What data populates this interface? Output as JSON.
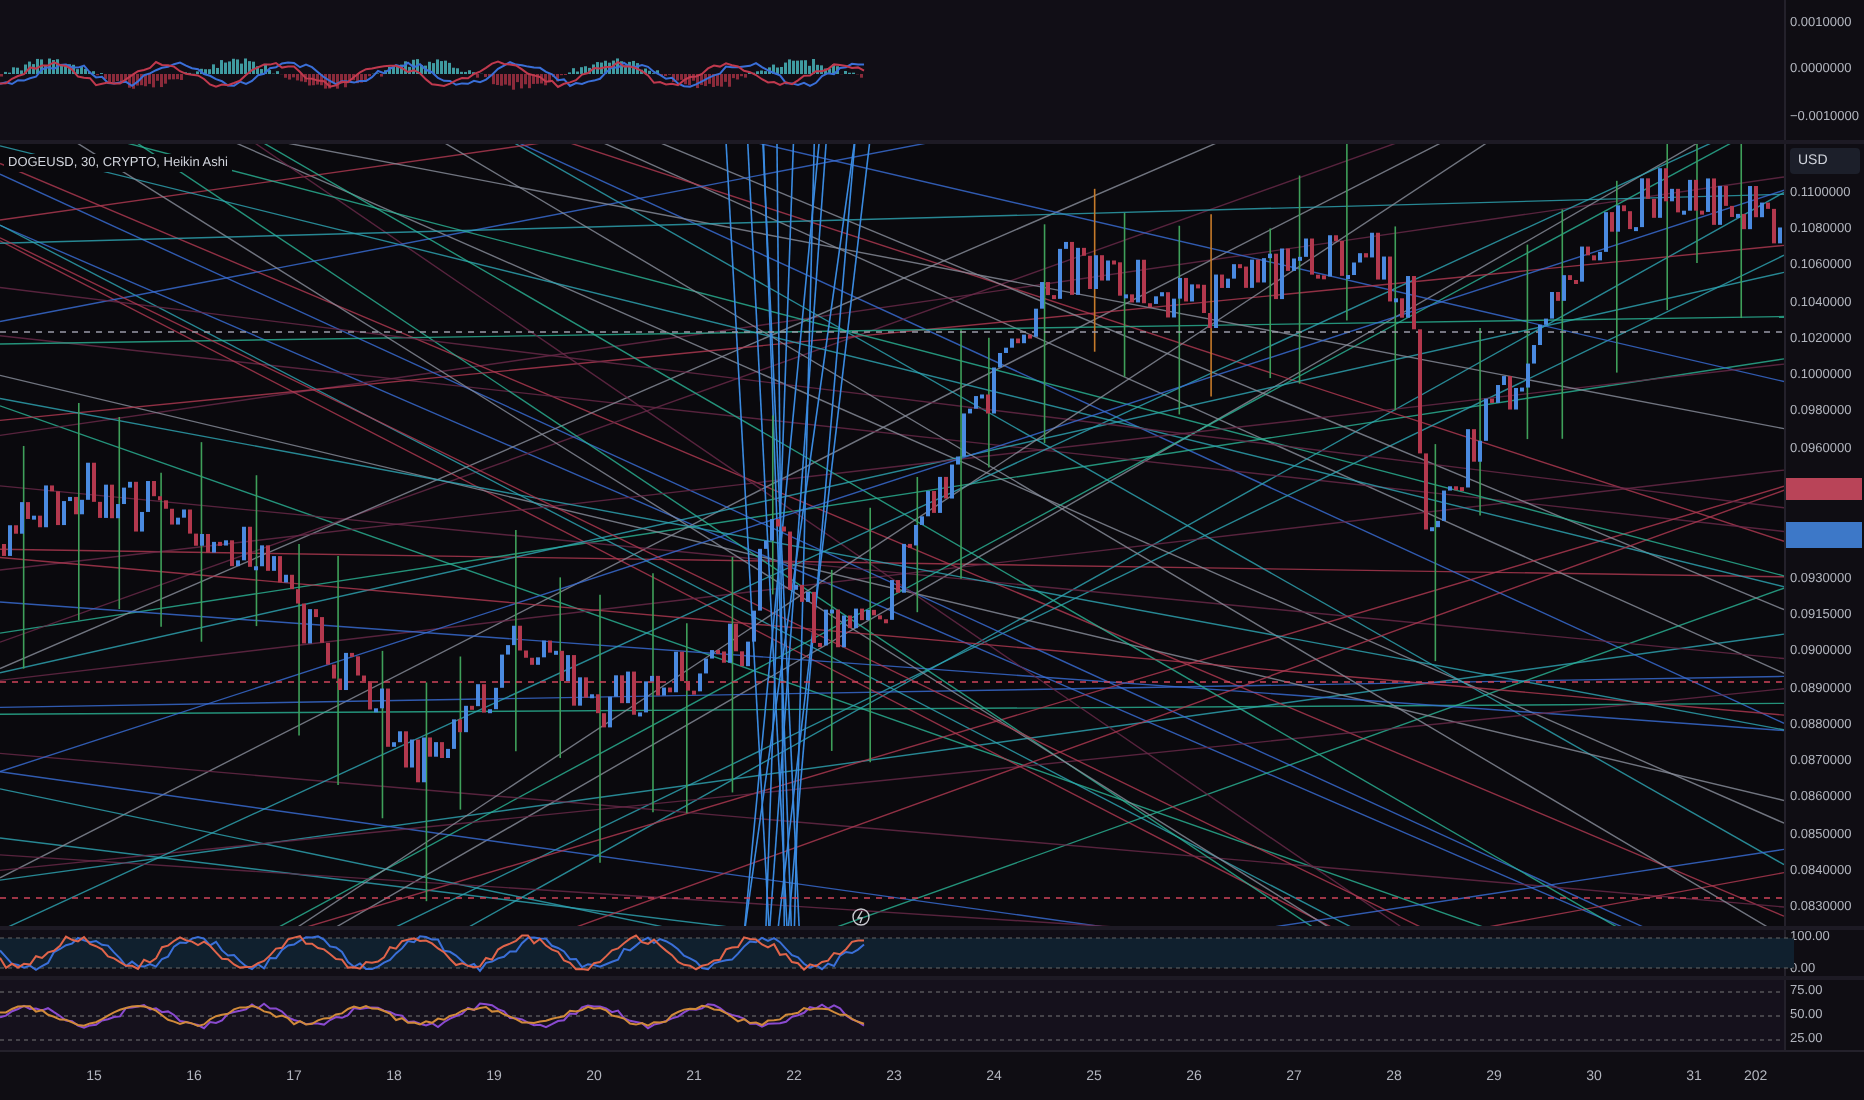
{
  "macd_pane": {
    "axis_labels": [
      "0.0010000",
      "0.0000000",
      "−0.0010000"
    ]
  },
  "main_pane": {
    "legend": "DOGEUSD, 30, CRYPTO, Heikin Ashi",
    "currency_button": "USD",
    "axis_labels": [
      "0.1100000",
      "0.1080000",
      "0.1060000",
      "0.1040000",
      "0.1020000",
      "0.1000000",
      "0.0980000",
      "0.0960000",
      "0.0930000",
      "0.0915000",
      "0.0900000",
      "0.0890000",
      "0.0880000",
      "0.0870000",
      "0.0860000",
      "0.0850000",
      "0.0840000",
      "0.0830000"
    ]
  },
  "stoch_pane": {
    "axis_labels": [
      "100.00",
      "0.00"
    ]
  },
  "rsi_pane": {
    "axis_labels": [
      "75.00",
      "50.00",
      "25.00"
    ]
  },
  "time_axis": [
    "15",
    "16",
    "17",
    "18",
    "19",
    "20",
    "21",
    "22",
    "23",
    "24",
    "25",
    "26",
    "27",
    "28",
    "29",
    "30",
    "31",
    "202"
  ]
}
